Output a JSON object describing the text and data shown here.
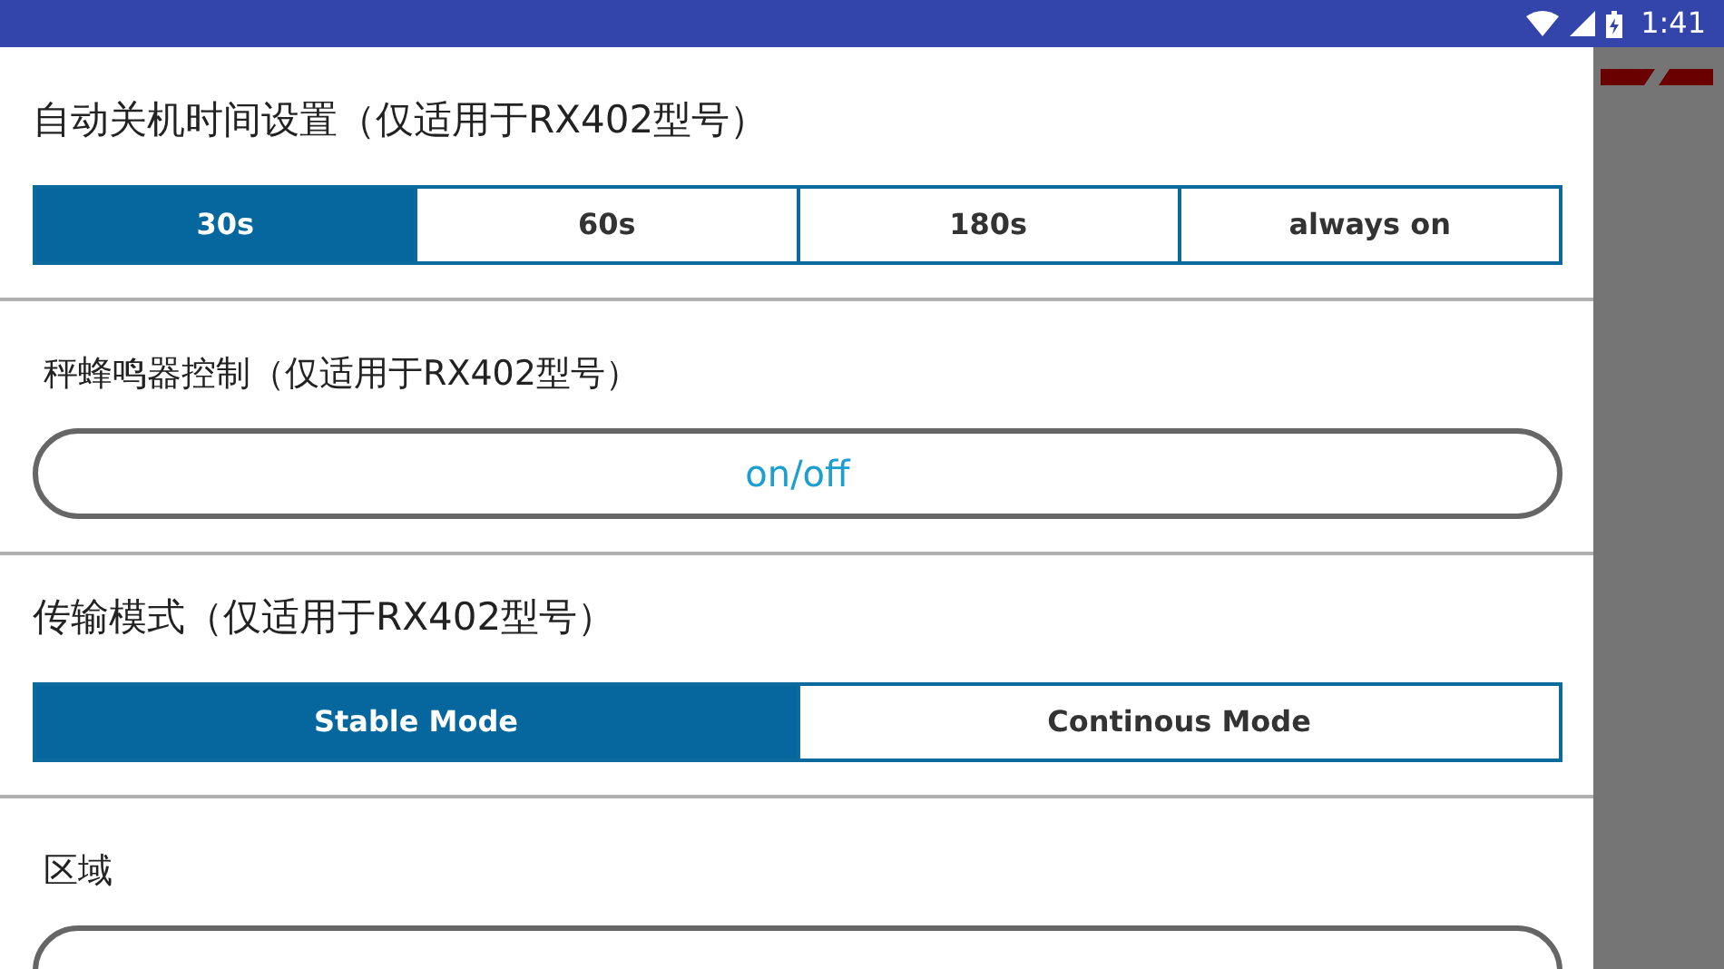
{
  "status_bar": {
    "time": "1:41"
  },
  "sections": [
    {
      "kind": "segmented",
      "title": "自动关机时间设置（仅适用于RX402型号）",
      "options": [
        {
          "label": "30s",
          "selected": true
        },
        {
          "label": "60s",
          "selected": false
        },
        {
          "label": "180s",
          "selected": false
        },
        {
          "label": "always on",
          "selected": false
        }
      ]
    },
    {
      "kind": "pill",
      "title": "秤蜂鸣器控制（仅适用于RX402型号）",
      "button": "on/off"
    },
    {
      "kind": "segmented",
      "title": "传输模式（仅适用于RX402型号）",
      "options": [
        {
          "label": "Stable Mode",
          "selected": true
        },
        {
          "label": "Continous Mode",
          "selected": false
        }
      ]
    },
    {
      "kind": "pill",
      "title": "区域"
    }
  ]
}
